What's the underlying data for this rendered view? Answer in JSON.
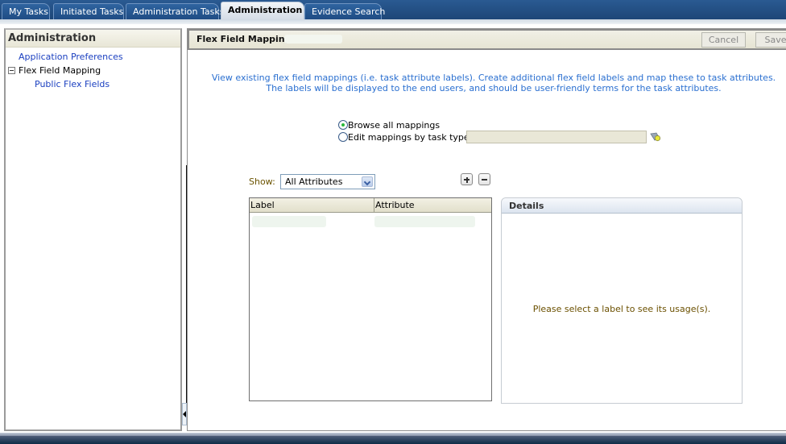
{
  "tabs": [
    {
      "label": "My Tasks",
      "active": false
    },
    {
      "label": "Initiated Tasks",
      "active": false
    },
    {
      "label": "Administration Tasks",
      "active": false
    },
    {
      "label": "Administration",
      "active": true
    },
    {
      "label": "Evidence Search",
      "active": false
    }
  ],
  "sidebar": {
    "title": "Administration",
    "items": [
      {
        "label": "Application Preferences",
        "type": "link"
      },
      {
        "label": "Flex Field Mapping",
        "type": "node",
        "expanded": true
      },
      {
        "label": "Public Flex Fields",
        "type": "link"
      }
    ]
  },
  "main": {
    "title": "Flex Field Mapping",
    "cancel_label": "Cancel",
    "save_label": "Save",
    "intro_line1": "View existing flex field mappings (i.e. task attribute labels). Create additional flex field labels and map these to task attributes.",
    "intro_line2": "The labels will be displayed to the end users, and should be user-friendly terms for the task attributes.",
    "mode": {
      "browse_label": "Browse all mappings",
      "edit_label": "Edit mappings by task type:",
      "selected": "browse",
      "task_type_value": ""
    },
    "show_label": "Show:",
    "show_value": "All Attributes",
    "table": {
      "columns": [
        "Label",
        "Attribute"
      ]
    },
    "details": {
      "title": "Details",
      "message": "Please select a label to see its usage(s)."
    }
  },
  "colors": {
    "tab_bar": "#1d4677",
    "link": "#1a3fc0",
    "intro_text": "#2a6fd0",
    "label_text": "#6b5300",
    "radio_selected": "#28b83a"
  }
}
